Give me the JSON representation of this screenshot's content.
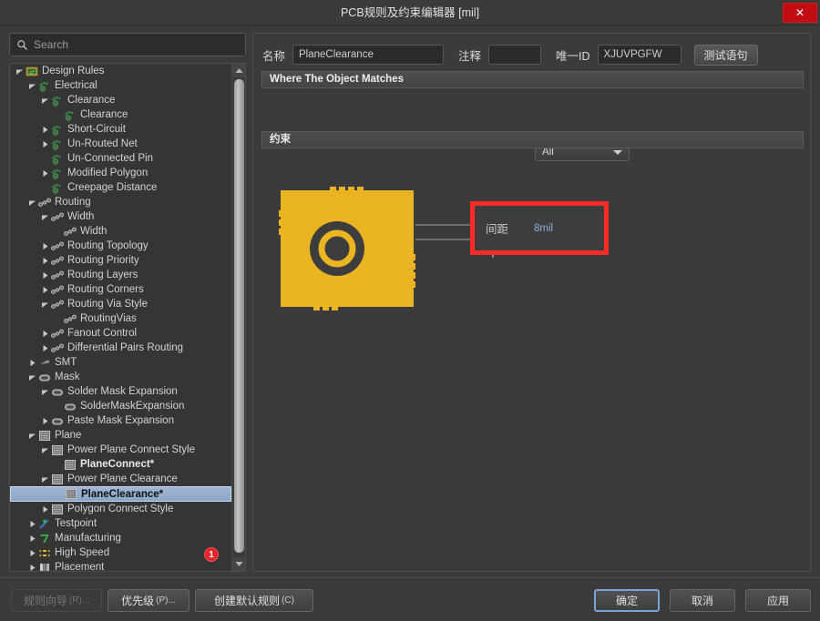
{
  "window": {
    "title": "PCB规则及约束编辑器 [mil]",
    "close_label": "✕",
    "close_icon": "close-icon"
  },
  "sidebar": {
    "search": {
      "placeholder": "Search",
      "value": "",
      "icon": "search-icon"
    },
    "badge": "1",
    "tree": [
      {
        "label": "Design Rules",
        "depth": 0,
        "state": "expanded",
        "icon": "design-rules-icon"
      },
      {
        "label": "Electrical",
        "depth": 1,
        "state": "expanded",
        "icon": "electrical-icon"
      },
      {
        "label": "Clearance",
        "depth": 2,
        "state": "expanded",
        "icon": "electrical-icon"
      },
      {
        "label": "Clearance",
        "depth": 3,
        "state": "leaf",
        "icon": "electrical-icon"
      },
      {
        "label": "Short-Circuit",
        "depth": 2,
        "state": "collapsed",
        "icon": "electrical-icon"
      },
      {
        "label": "Un-Routed Net",
        "depth": 2,
        "state": "collapsed",
        "icon": "electrical-icon"
      },
      {
        "label": "Un-Connected Pin",
        "depth": 2,
        "state": "leaf-indent",
        "icon": "electrical-icon"
      },
      {
        "label": "Modified Polygon",
        "depth": 2,
        "state": "collapsed",
        "icon": "electrical-icon"
      },
      {
        "label": "Creepage Distance",
        "depth": 2,
        "state": "leaf-indent",
        "icon": "electrical-icon"
      },
      {
        "label": "Routing",
        "depth": 1,
        "state": "expanded",
        "icon": "routing-icon"
      },
      {
        "label": "Width",
        "depth": 2,
        "state": "expanded",
        "icon": "routing-icon"
      },
      {
        "label": "Width",
        "depth": 3,
        "state": "leaf",
        "icon": "routing-icon"
      },
      {
        "label": "Routing Topology",
        "depth": 2,
        "state": "collapsed",
        "icon": "routing-icon"
      },
      {
        "label": "Routing Priority",
        "depth": 2,
        "state": "collapsed",
        "icon": "routing-icon"
      },
      {
        "label": "Routing Layers",
        "depth": 2,
        "state": "collapsed",
        "icon": "routing-icon"
      },
      {
        "label": "Routing Corners",
        "depth": 2,
        "state": "collapsed",
        "icon": "routing-icon"
      },
      {
        "label": "Routing Via Style",
        "depth": 2,
        "state": "expanded",
        "icon": "routing-icon"
      },
      {
        "label": "RoutingVias",
        "depth": 3,
        "state": "leaf",
        "icon": "routing-icon"
      },
      {
        "label": "Fanout Control",
        "depth": 2,
        "state": "collapsed",
        "icon": "routing-icon"
      },
      {
        "label": "Differential Pairs Routing",
        "depth": 2,
        "state": "collapsed",
        "icon": "routing-icon"
      },
      {
        "label": "SMT",
        "depth": 1,
        "state": "collapsed",
        "icon": "smt-icon"
      },
      {
        "label": "Mask",
        "depth": 1,
        "state": "expanded",
        "icon": "mask-icon"
      },
      {
        "label": "Solder Mask Expansion",
        "depth": 2,
        "state": "expanded",
        "icon": "mask-icon"
      },
      {
        "label": "SolderMaskExpansion",
        "depth": 3,
        "state": "leaf",
        "icon": "mask-icon"
      },
      {
        "label": "Paste Mask Expansion",
        "depth": 2,
        "state": "collapsed",
        "icon": "mask-icon"
      },
      {
        "label": "Plane",
        "depth": 1,
        "state": "expanded",
        "icon": "plane-icon"
      },
      {
        "label": "Power Plane Connect Style",
        "depth": 2,
        "state": "expanded",
        "icon": "plane-icon"
      },
      {
        "label": "PlaneConnect*",
        "depth": 3,
        "state": "leaf-bold",
        "icon": "plane-icon"
      },
      {
        "label": "Power Plane Clearance",
        "depth": 2,
        "state": "expanded",
        "icon": "plane-icon"
      },
      {
        "label": "PlaneClearance*",
        "depth": 3,
        "state": "selected",
        "icon": "plane-icon"
      },
      {
        "label": "Polygon Connect Style",
        "depth": 2,
        "state": "collapsed",
        "icon": "plane-icon"
      },
      {
        "label": "Testpoint",
        "depth": 1,
        "state": "collapsed",
        "icon": "testpoint-icon"
      },
      {
        "label": "Manufacturing",
        "depth": 1,
        "state": "collapsed",
        "icon": "manufacturing-icon"
      },
      {
        "label": "High Speed",
        "depth": 1,
        "state": "collapsed",
        "icon": "highspeed-icon"
      },
      {
        "label": "Placement",
        "depth": 1,
        "state": "collapsed",
        "icon": "placement-icon"
      }
    ]
  },
  "form": {
    "name_label": "名称",
    "name_value": "PlaneClearance",
    "comment_label": "注释",
    "comment_value": "",
    "uid_label": "唯一ID",
    "uid_value": "XJUVPGFW",
    "test_button": "测试语句"
  },
  "where_section": {
    "header": "Where The Object Matches",
    "scope_value": "All",
    "scope_options": [
      "All"
    ]
  },
  "constraint_section": {
    "header": "约束",
    "clearance_label": "间距",
    "clearance_value": "8mil",
    "highlight_color": "#ff2b2b",
    "pad_color": "#eab423",
    "value_color": "#8fb0d8"
  },
  "footer": {
    "rule_wizard": "规则向导",
    "rule_wizard_mnemonic": "(R)...",
    "priority": "优先级",
    "priority_mnemonic": "(P)...",
    "create_default": "创建默认规则",
    "create_default_mnemonic": "(C)",
    "ok": "确定",
    "cancel": "取消",
    "apply": "应用"
  }
}
